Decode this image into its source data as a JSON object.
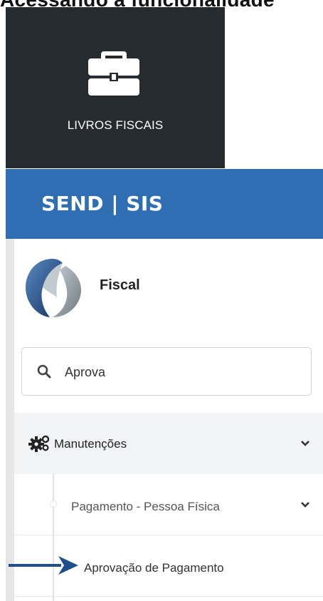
{
  "caption": "Acessando a funcionalidade",
  "tile": {
    "label": "LIVROS FISCAIS",
    "icon": "briefcase-icon"
  },
  "header": {
    "brand": "SEND | SIS"
  },
  "sidebar": {
    "module_name": "Fiscal",
    "search": {
      "value": "Aprova",
      "icon": "search-icon"
    },
    "menu": {
      "manutencoes": {
        "label": "Manutenções",
        "icon": "gears-icon"
      },
      "pagamento_pf": {
        "label": "Pagamento - Pessoa Física"
      },
      "aprovacao": {
        "label": "Aprovação de Pagamento"
      }
    }
  },
  "colors": {
    "tile_bg": "#262b2f",
    "header_bg": "#2f6eb3",
    "arrow": "#1f4e8c"
  }
}
